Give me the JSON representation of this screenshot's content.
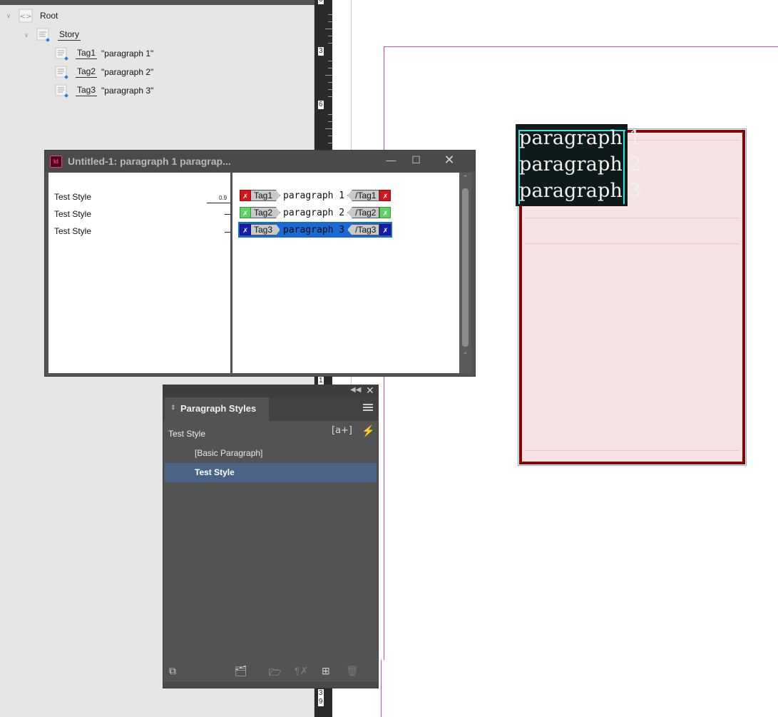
{
  "structure": {
    "root_label": "Root",
    "story_label": "Story",
    "tags": [
      {
        "name": "Tag1",
        "content": "\"paragraph 1\""
      },
      {
        "name": "Tag2",
        "content": "\"paragraph 2\""
      },
      {
        "name": "Tag3",
        "content": "\"paragraph 3\""
      }
    ]
  },
  "ruler": {
    "labels": [
      "6",
      "3",
      "6",
      "1",
      "3",
      "9"
    ]
  },
  "document": {
    "paragraphs": [
      "paragraph 1",
      "paragraph 2",
      "paragraph 3"
    ]
  },
  "story_editor": {
    "title": "Untitled-1: paragraph 1 paragrap...",
    "minimize_glyph": "—",
    "maximize_glyph": "☐",
    "close_glyph": "✕",
    "style_column": [
      "Test Style",
      "Test Style",
      "Test Style"
    ],
    "depth_value": "0.9",
    "lines": [
      {
        "open_tag": "Tag1",
        "text": "paragraph 1",
        "close_tag": "/Tag1",
        "color": "#d0151b",
        "selected": false
      },
      {
        "open_tag": "Tag2",
        "text": "paragraph 2",
        "close_tag": "/Tag2",
        "color": "#5fd35f",
        "selected": false
      },
      {
        "open_tag": "Tag3",
        "text": "paragraph 3",
        "close_tag": "/Tag3",
        "color": "#1a1aa8",
        "selected": true
      }
    ]
  },
  "paragraph_styles": {
    "tab_label": "Paragraph Styles",
    "current_style": "Test Style",
    "new_style_badge": "[a+]",
    "items": [
      {
        "label": "[Basic Paragraph]",
        "selected": false
      },
      {
        "label": "Test Style",
        "selected": true
      }
    ]
  },
  "colors": {
    "structure_bg": "#e6e6e6",
    "panel_bg": "#535353",
    "selection_blue": "#4b6485",
    "frame_border": "#8b0000",
    "frame_fill": "#f5e3e4",
    "margin_guide": "#c44dc4"
  }
}
